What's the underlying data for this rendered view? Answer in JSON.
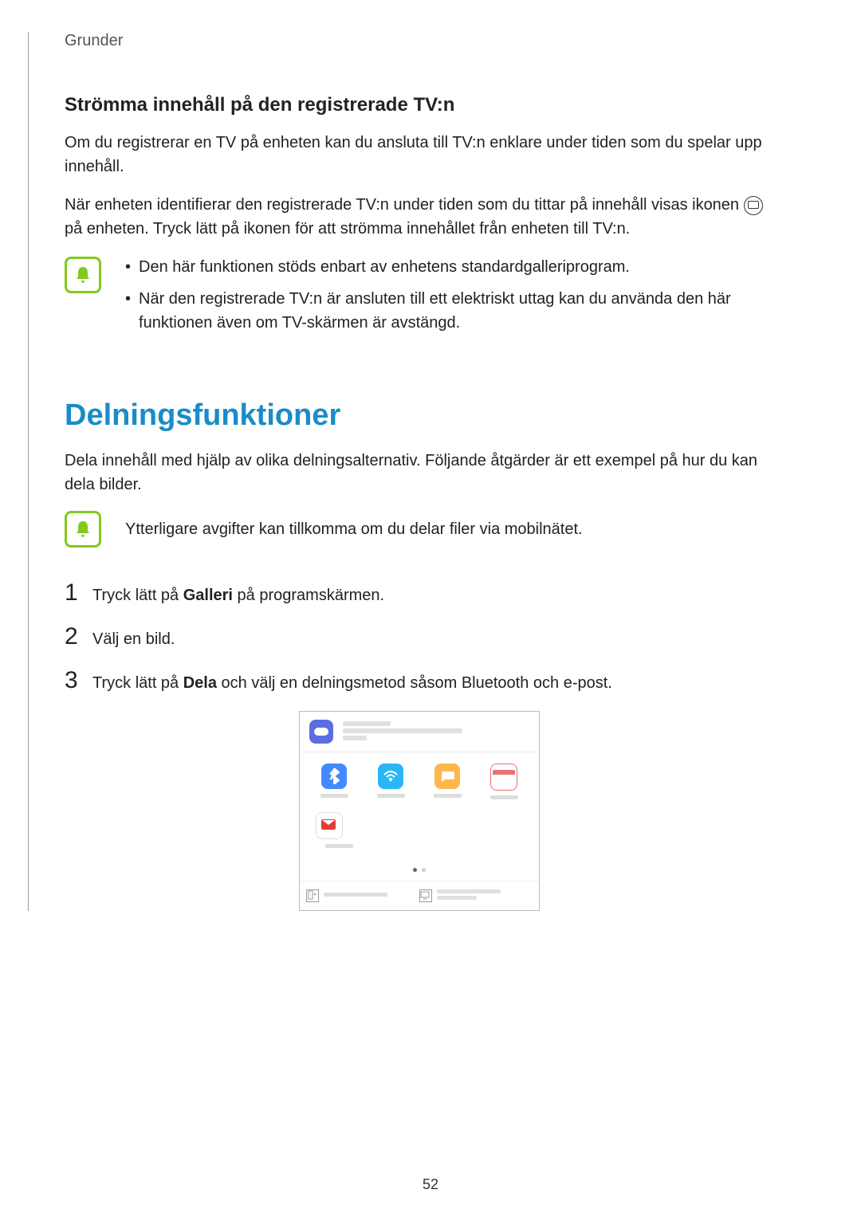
{
  "breadcrumb": "Grunder",
  "section1": {
    "heading": "Strömma innehåll på den registrerade TV:n",
    "para1": "Om du registrerar en TV på enheten kan du ansluta till TV:n enklare under tiden som du spelar upp innehåll.",
    "para2a": "När enheten identifierar den registrerade TV:n under tiden som du tittar på innehåll visas ikonen ",
    "para2b": " på enheten. Tryck lätt på ikonen för att strömma innehållet från enheten till TV:n.",
    "notes": [
      "Den här funktionen stöds enbart av enhetens standardgalleriprogram.",
      "När den registrerade TV:n är ansluten till ett elektriskt uttag kan du använda den här funktionen även om TV-skärmen är avstängd."
    ]
  },
  "section2": {
    "heading": "Delningsfunktioner",
    "intro": "Dela innehåll med hjälp av olika delningsalternativ. Följande åtgärder är ett exempel på hur du kan dela bilder.",
    "note": "Ytterligare avgifter kan tillkomma om du delar filer via mobilnätet.",
    "steps": [
      {
        "n": "1",
        "pre": "Tryck lätt på ",
        "bold": "Galleri",
        "post": " på programskärmen."
      },
      {
        "n": "2",
        "pre": "Välj en bild.",
        "bold": "",
        "post": ""
      },
      {
        "n": "3",
        "pre": "Tryck lätt på ",
        "bold": "Dela",
        "post": " och välj en delningsmetod såsom Bluetooth och e-post."
      }
    ]
  },
  "page_number": "52"
}
